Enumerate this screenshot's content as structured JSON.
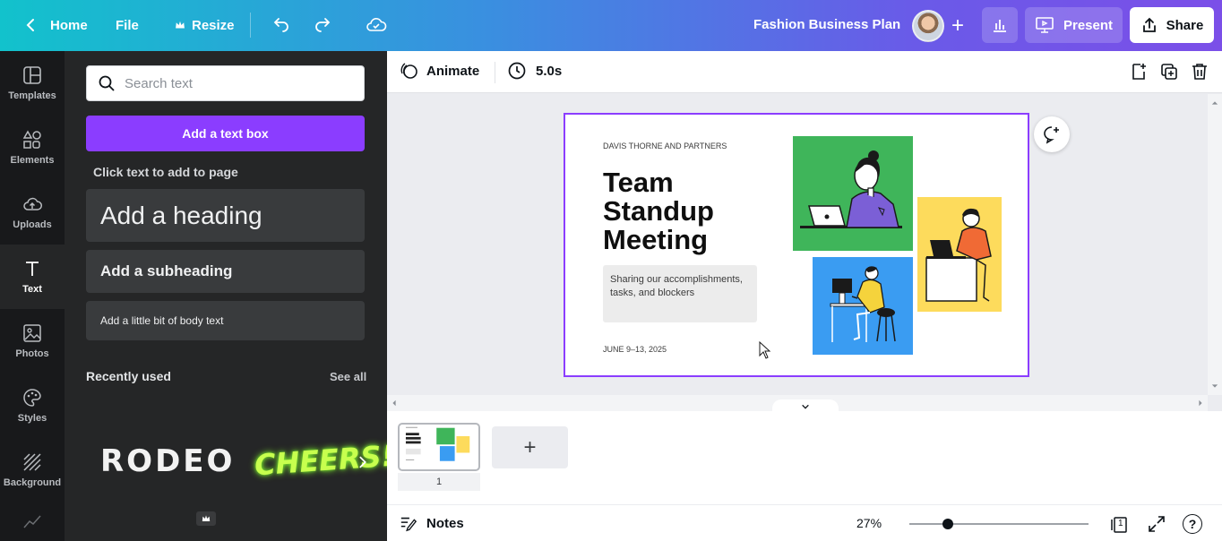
{
  "topbar": {
    "home_label": "Home",
    "file_label": "File",
    "resize_label": "Resize",
    "doc_title": "Fashion Business Plan",
    "present_label": "Present",
    "share_label": "Share"
  },
  "rail": {
    "items": [
      {
        "label": "Templates"
      },
      {
        "label": "Elements"
      },
      {
        "label": "Uploads"
      },
      {
        "label": "Text"
      },
      {
        "label": "Photos"
      },
      {
        "label": "Styles"
      },
      {
        "label": "Background"
      }
    ]
  },
  "panel": {
    "search_placeholder": "Search text",
    "add_textbox_label": "Add a text box",
    "click_hint": "Click text to add to page",
    "heading_label": "Add a heading",
    "subheading_label": "Add a subheading",
    "body_label": "Add a little bit of body text",
    "recent_title": "Recently used",
    "see_all_label": "See all",
    "recent_items": [
      "RODEO",
      "CHEERS!"
    ]
  },
  "editor": {
    "animate_label": "Animate",
    "duration_label": "5.0s"
  },
  "slide": {
    "company": "DAVIS THORNE AND PARTNERS",
    "title": "Team Standup Meeting",
    "description": "Sharing our accomplishments, tasks, and blockers",
    "date": "JUNE 9–13, 2025"
  },
  "pages": {
    "page_number": "1",
    "add_page_label": "+"
  },
  "bottombar": {
    "notes_label": "Notes",
    "zoom_label": "27%",
    "zoom_fraction": 0.27,
    "page_count": "1"
  },
  "colors": {
    "accent": "#8b3dff",
    "panel_bg": "#252627",
    "rail_bg": "#18191b",
    "green": "#3fb55a",
    "yellow": "#fddb5c",
    "blue": "#3a9cf2"
  }
}
